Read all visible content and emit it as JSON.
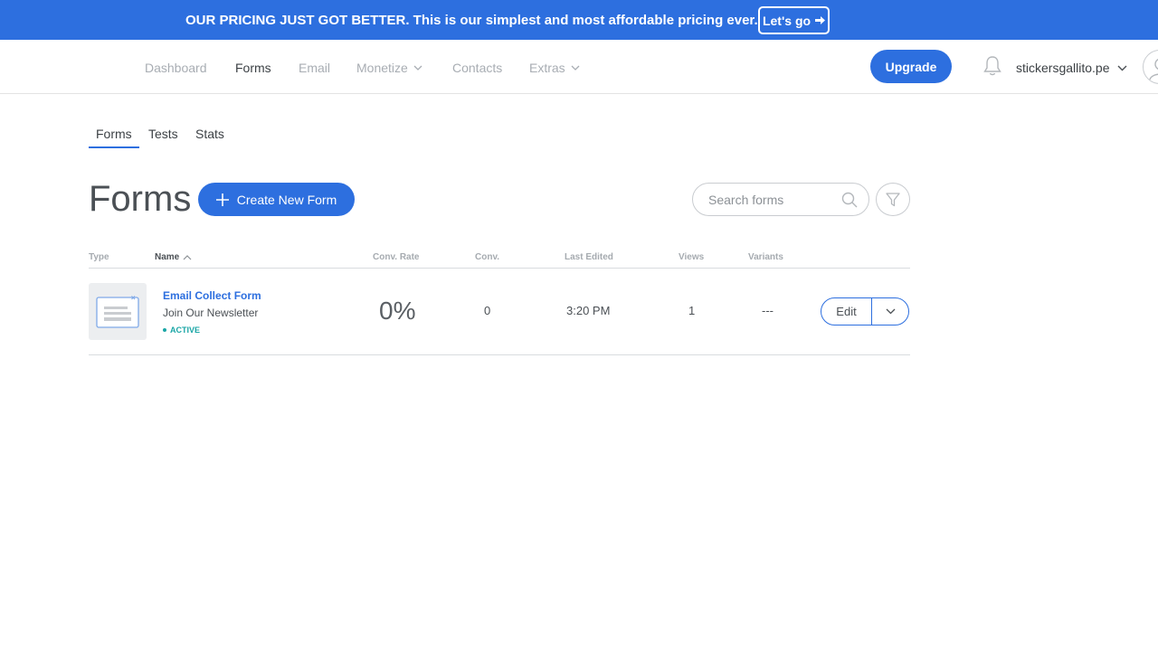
{
  "banner": {
    "text": "OUR PRICING JUST GOT BETTER. This is our simplest and most affordable pricing ever.",
    "cta_label": "Let's go",
    "cta_icon": "arrow-right-icon",
    "background": "#2d6fdf"
  },
  "nav": {
    "items": [
      {
        "label": "Dashboard",
        "active": false
      },
      {
        "label": "Forms",
        "active": true
      },
      {
        "label": "Email",
        "active": false
      },
      {
        "label": "Monetize",
        "active": false,
        "has_dropdown": true
      },
      {
        "label": "Contacts",
        "active": false
      },
      {
        "label": "Extras",
        "active": false,
        "has_dropdown": true
      }
    ],
    "upgrade_label": "Upgrade",
    "account_name": "stickersgallito.pe"
  },
  "subtabs": {
    "items": [
      {
        "label": "Forms",
        "active": true
      },
      {
        "label": "Tests",
        "active": false
      },
      {
        "label": "Stats",
        "active": false
      }
    ]
  },
  "page": {
    "title": "Forms",
    "create_button_label": "Create New Form",
    "search_placeholder": "Search forms"
  },
  "table": {
    "columns": [
      "Type",
      "Name",
      "Conv. Rate",
      "Conv.",
      "Last Edited",
      "Views",
      "Variants"
    ],
    "sort_column": "Name",
    "rows": [
      {
        "name": "Email Collect Form",
        "subtitle": "Join Our Newsletter",
        "status": "ACTIVE",
        "conv_rate": "0%",
        "conv": "0",
        "last_edited": "3:20 PM",
        "views": "1",
        "variants": "---",
        "edit_label": "Edit"
      }
    ]
  },
  "colors": {
    "accent": "#2d6fdf",
    "active_status": "#1aa6a6"
  }
}
